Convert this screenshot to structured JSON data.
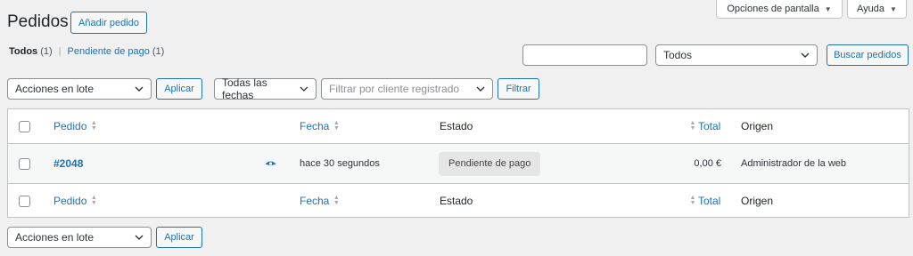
{
  "header": {
    "title": "Pedidos",
    "add_button": "Añadir pedido"
  },
  "screen_meta": {
    "options_label": "Opciones de pantalla",
    "help_label": "Ayuda"
  },
  "subsubsub": {
    "all_label": "Todos",
    "all_count": "(1)",
    "separator": "|",
    "pending_label": "Pendiente de pago",
    "pending_count": "(1)"
  },
  "search": {
    "input_value": "",
    "status_select": "Todos",
    "button": "Buscar pedidos"
  },
  "top_nav": {
    "bulk_select": "Acciones en lote",
    "apply_button": "Aplicar",
    "date_select": "Todas las fechas",
    "customer_placeholder": "Filtrar por cliente registrado",
    "filter_button": "Filtrar"
  },
  "table": {
    "columns": {
      "order": "Pedido",
      "date": "Fecha",
      "status": "Estado",
      "total": "Total",
      "origin": "Origen"
    },
    "rows": [
      {
        "order": "#2048",
        "date": "hace 30 segundos",
        "status": "Pendiente de pago",
        "total": "0,00 €",
        "origin": "Administrador de la web"
      }
    ]
  },
  "bottom_nav": {
    "bulk_select": "Acciones en lote",
    "apply_button": "Aplicar"
  },
  "colors": {
    "accent": "#2271b1",
    "background": "#f0f0f1",
    "status_pending_bg": "#e5e5e5"
  },
  "icons": {
    "preview": "eye-icon",
    "sort": "sort-arrows-icon",
    "dropdown": "chevron-down-icon"
  }
}
